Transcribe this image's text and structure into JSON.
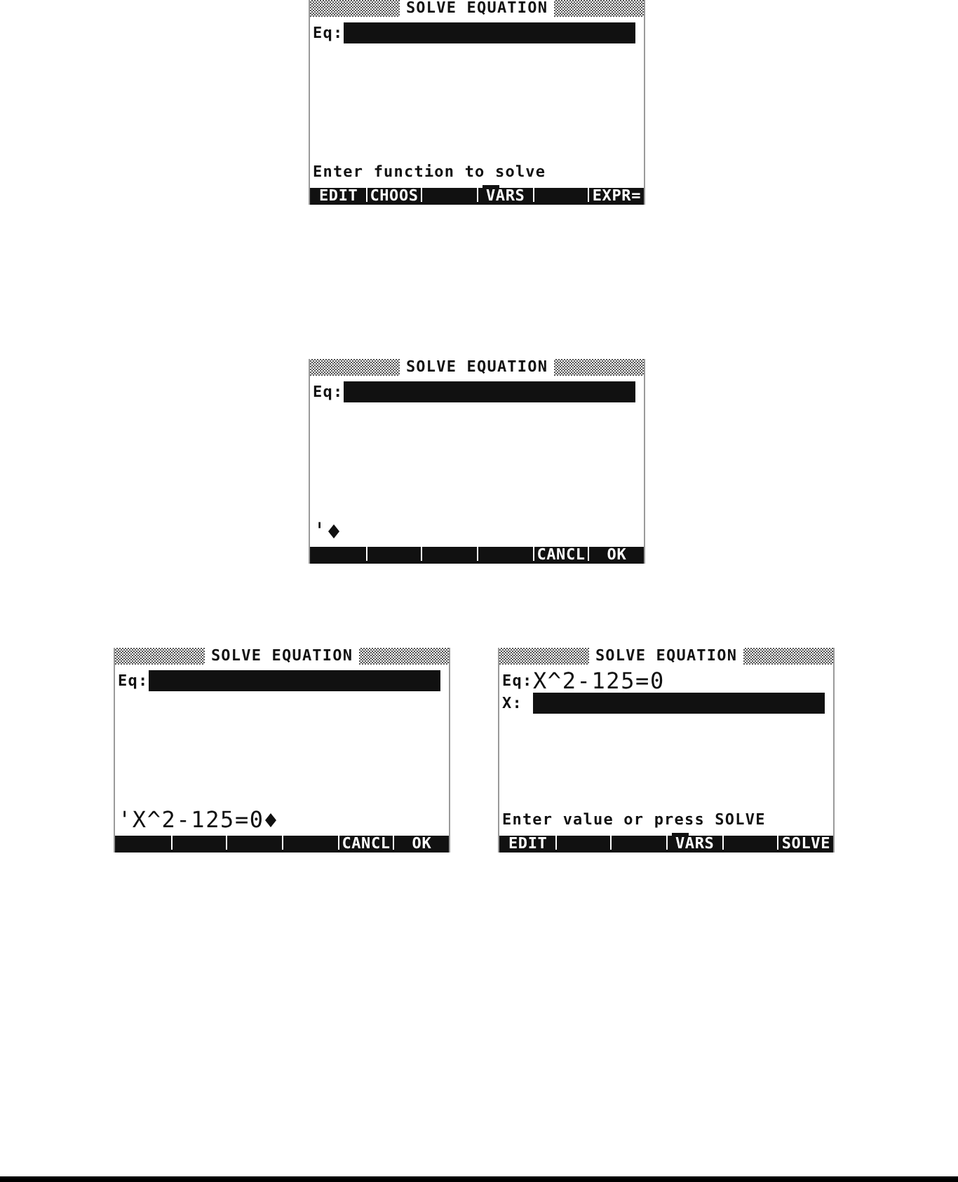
{
  "screens": [
    {
      "title": "SOLVE EQUATION",
      "fields": [
        {
          "label": "Eq:",
          "selected": true
        }
      ],
      "status": "Enter function to solve",
      "menu_keys": [
        {
          "kind": "command",
          "label": "EDIT"
        },
        {
          "kind": "command",
          "label": "CHOOS"
        },
        {
          "kind": "blank"
        },
        {
          "kind": "directory",
          "label": "VARS"
        },
        {
          "kind": "blank"
        },
        {
          "kind": "command",
          "label": "EXPR="
        }
      ]
    },
    {
      "title": "SOLVE EQUATION",
      "fields": [
        {
          "label": "Eq:",
          "selected": true
        }
      ],
      "command_line": {
        "text": "'"
      },
      "menu_keys": [
        {
          "kind": "blank"
        },
        {
          "kind": "blank"
        },
        {
          "kind": "blank"
        },
        {
          "kind": "blank"
        },
        {
          "kind": "command",
          "label": "CANCL"
        },
        {
          "kind": "command",
          "label": "OK"
        }
      ]
    },
    {
      "title": "SOLVE EQUATION",
      "fields": [
        {
          "label": "Eq:",
          "selected": true
        }
      ],
      "command_line": {
        "text": "'X^2-125=0"
      },
      "menu_keys": [
        {
          "kind": "blank"
        },
        {
          "kind": "blank"
        },
        {
          "kind": "blank"
        },
        {
          "kind": "blank"
        },
        {
          "kind": "command",
          "label": "CANCL"
        },
        {
          "kind": "command",
          "label": "OK"
        }
      ]
    },
    {
      "title": "SOLVE EQUATION",
      "fields": [
        {
          "label": "Eq:",
          "value": "X^2-125=0",
          "selected": false
        },
        {
          "label": "X:",
          "selected": true
        }
      ],
      "status": "Enter value or press SOLVE",
      "menu_keys": [
        {
          "kind": "command",
          "label": "EDIT"
        },
        {
          "kind": "blank"
        },
        {
          "kind": "blank"
        },
        {
          "kind": "directory",
          "label": "VARS"
        },
        {
          "kind": "blank"
        },
        {
          "kind": "command",
          "label": "SOLVE"
        }
      ]
    }
  ]
}
